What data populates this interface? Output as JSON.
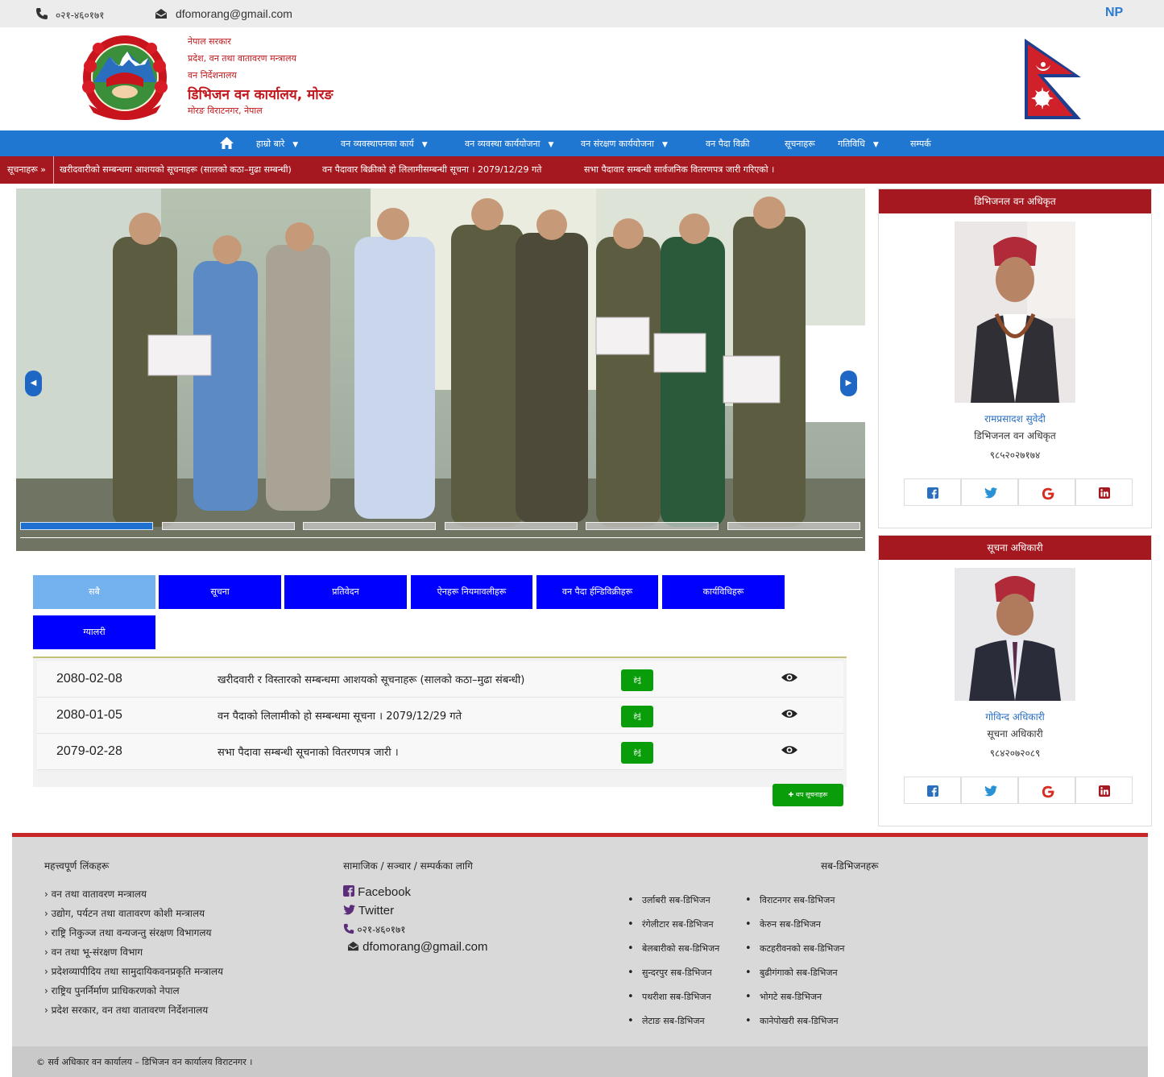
{
  "topbar": {
    "phone": "०२१-४६०१७१",
    "email": "dfomorang@gmail.com",
    "language": "NP"
  },
  "header": {
    "line1": "नेपाल सरकार",
    "line2": "प्रदेश, वन तथा वातावरण मन्त्रालय",
    "line3": "वन निर्देशनालय",
    "office_name": "डिभिजन वन कार्यालय, मोरङ",
    "address": "मोरङ विराटनगर, नेपाल"
  },
  "nav": {
    "items": [
      {
        "label": "हाम्रो बारे",
        "caret": "▼"
      },
      {
        "label": "वन व्यवस्थापनका कार्य",
        "caret": "▼"
      },
      {
        "label": "वन व्यवस्था कार्ययोजना",
        "caret": "▼"
      },
      {
        "label": "वन संरक्षण कार्ययोजना",
        "caret": "▼"
      },
      {
        "label": "वन पैदा विक्री",
        "caret": ""
      },
      {
        "label": "सूचनाहरू",
        "caret": ""
      },
      {
        "label": "गतिविधि",
        "caret": "▼"
      },
      {
        "label": "सम्पर्क",
        "caret": ""
      }
    ]
  },
  "ticker": {
    "label": "सूचनाहरू »",
    "items": [
      "खरीदवारीको सम्बन्धमा आशयको सूचनाहरू (सालको कठा–मुढा सम्बन्धी)",
      "वन पैदावार बिक्रीको हो लिलामीसम्बन्धी सूचना । 2079/12/29 गते",
      "सभा पैदावार सम्बन्धी सार्वजनिक वितरणपत्र जारी गरिएको ।"
    ]
  },
  "slider": {
    "prev_icon": "chevron-left-icon",
    "next_icon": "chevron-right-icon",
    "prev_glyph": "◀",
    "next_glyph": "▶",
    "slide_count": 6,
    "active_slide": 1
  },
  "tabs": [
    {
      "label": "सबै",
      "active": true
    },
    {
      "label": "सूचना",
      "active": false
    },
    {
      "label": "प्रतिवेदन",
      "active": false
    },
    {
      "label": "ऐनहरू नियमावलीहरू",
      "active": false
    },
    {
      "label": "वन पैदा र्हन्डिविक्रीहरू",
      "active": false
    },
    {
      "label": "कार्यविधिहरू",
      "active": false
    },
    {
      "label": "ग्यालरी",
      "active": false
    }
  ],
  "notices": [
    {
      "date": "2080-02-08",
      "title": "खरीदवारी र विस्तारको सम्बन्धमा आशयको सूचनाहरू (सालको कठा–मुढा संबन्धी)",
      "download": "हेर्नु"
    },
    {
      "date": "2080-01-05",
      "title": "वन पैदाको लिलामीको हो सम्बन्धमा सूचना । 2079/12/29 गते",
      "download": "हेर्नु"
    },
    {
      "date": "2079-02-28",
      "title": "सभा पैदावा सम्बन्धी सूचनाको वितरणपत्र जारी ।",
      "download": "हेर्नु"
    }
  ],
  "more_button": "थप सूचनाहरू",
  "officers": [
    {
      "heading": "डिभिजनल वन अधिकृत",
      "name": "रामप्रसादश सुवेदी",
      "position": "डिभिजनल वन अधिकृत",
      "phone": "९८५२०२७१७४"
    },
    {
      "heading": "सूचना अधिकारी",
      "name": "गोविन्द अधिकारी",
      "position": "सूचना अधिकारी",
      "phone": "९८४२०७२०८९"
    }
  ],
  "footer": {
    "links_heading": "महत्त्वपूर्ण लिंकहरू",
    "links": [
      "वन तथा वातावरण मन्त्रालय",
      "उद्योग, पर्यटन तथा वातावरण कोशी मन्त्रालय",
      "राष्ट्रि निकुञ्ज तथा वन्यजन्तु संरक्षण विभागलय",
      "वन तथा भू-संरक्षण विभाग",
      "प्रदेशव्यापीदिय तथा सामुदायिकवनप्रकृति मन्त्रालय",
      "राष्ट्रिय पुनर्निर्माण प्राधिकरणको नेपाल",
      "प्रदेश सरकार, वन तथा वातावरण निर्देशनालय"
    ],
    "social_heading": "सामाजिक / सञ्चार / सम्पर्कका लागि",
    "social": [
      {
        "icon": "facebook-icon",
        "label": "Facebook"
      },
      {
        "icon": "twitter-icon",
        "label": "Twitter"
      },
      {
        "icon": "phone-icon",
        "label": "०२१-४६०१७१"
      },
      {
        "icon": "mail-icon",
        "label": "dfomorang@gmail.com"
      }
    ],
    "subdivisions_heading": "सब-डिभिजनहरू",
    "subdivisions_col1": [
      "उर्लाबरी सब-डिभिजन",
      "रंगेलीटार सब-डिभिजन",
      "बेलबारीको सब-डिभिजन",
      "सुन्दरपुर सब-डिभिजन",
      "पथरीशा सब-डिभिजन",
      "लेटाङ सब-डिभिजन"
    ],
    "subdivisions_col2": [
      "विराटनगर सब-डिभिजन",
      "केरुन सब-डिभिजन",
      "कटहरीवनको सब-डिभिजन",
      "बुढीगंगाको सब-डिभिजन",
      "भोगटे सब-डिभिजन",
      "कानेपोखरी सब-डिभिजन"
    ],
    "copyright": "© सर्व अधिकार वन कार्यालय – डिभिजन वन कार्यालय विराटनगर ।"
  },
  "colors": {
    "nav": "#2077d2",
    "ticker": "#a6181f",
    "tab": "#0000ff",
    "tab_active": "#74b1ef",
    "button_green": "#0a9d0a",
    "footer_accent": "#c82626"
  }
}
